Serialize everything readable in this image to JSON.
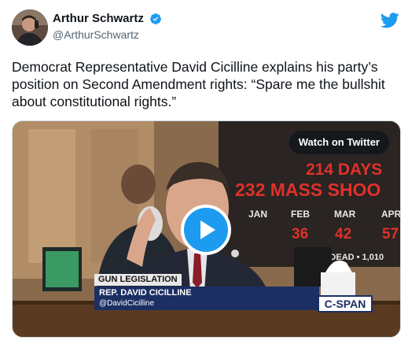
{
  "tweet": {
    "display_name": "Arthur Schwartz",
    "handle": "@ArthurSchwartz",
    "text": "Democrat Representative David Cicilline explains his party’s position on Second Amendment rights: “Spare me the bullshit about constitutional rights.”",
    "verified": true
  },
  "media": {
    "watch_label": "Watch on Twitter",
    "board": {
      "days_text": "214 DAYS",
      "mass_text": "232 MASS SHOO",
      "months": [
        "JAN",
        "FEB",
        "MAR",
        "APR"
      ],
      "month_values": [
        "36",
        "42",
        "57"
      ],
      "first_partial": "",
      "dead_text": "256 DEAD • 1,010"
    },
    "lower_third": {
      "tag": "GUN LEGISLATION",
      "name": "REP. DAVID CICILLINE",
      "handle": "@DavidCicilline"
    },
    "network_logo": "C-SPAN"
  },
  "colors": {
    "twitter_blue": "#1d9bf0",
    "board_red": "#e0312a",
    "lower_third_navy": "#1b2f63"
  }
}
